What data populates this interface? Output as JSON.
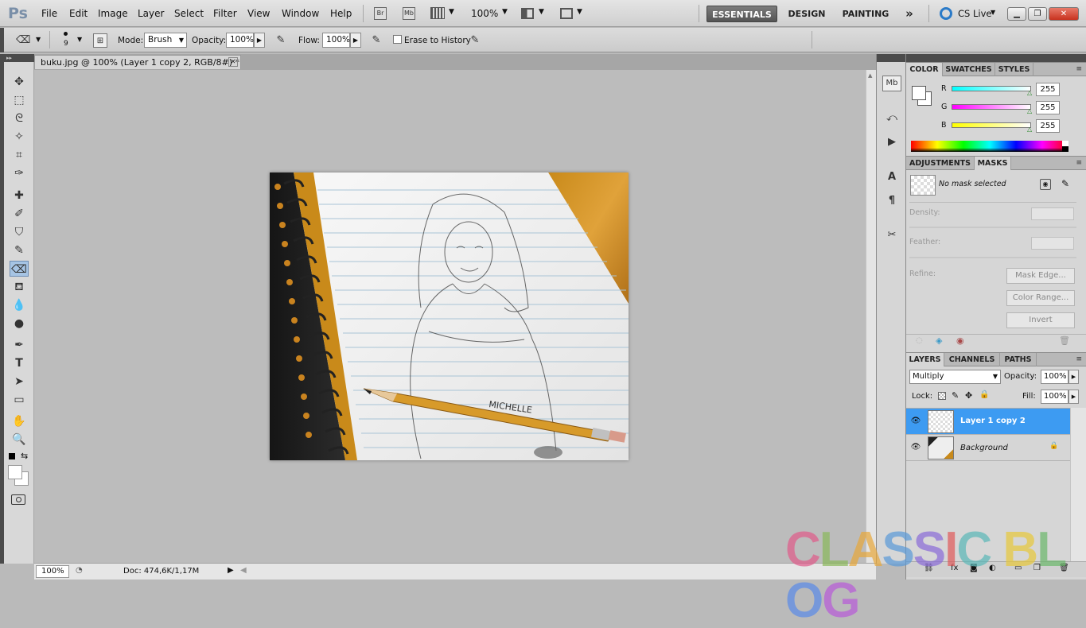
{
  "app": {
    "logo": "Ps"
  },
  "menu": [
    "File",
    "Edit",
    "Image",
    "Layer",
    "Select",
    "Filter",
    "View",
    "Window",
    "Help"
  ],
  "menubar_icons": {
    "bridge": "Br",
    "minibridge": "Mb",
    "zoom": "100%"
  },
  "workspaces": {
    "essentials": "ESSENTIALS",
    "design": "DESIGN",
    "painting": "PAINTING",
    "more": "»"
  },
  "cslive": "CS Live",
  "options": {
    "brush_size": "9",
    "mode_label": "Mode:",
    "mode_value": "Brush",
    "opacity_label": "Opacity:",
    "opacity_value": "100%",
    "flow_label": "Flow:",
    "flow_value": "100%",
    "erase_history_label": "Erase to History"
  },
  "document": {
    "tab_title": "buku.jpg @ 100% (Layer 1 copy 2, RGB/8#) *",
    "canvas_name_text": "MICHELLE"
  },
  "status": {
    "zoom": "100%",
    "doc": "Doc: 474,6K/1,17M"
  },
  "color_panel": {
    "tabs": [
      "COLOR",
      "SWATCHES",
      "STYLES"
    ],
    "channels": [
      {
        "label": "R",
        "value": "255",
        "color": "#00ffff"
      },
      {
        "label": "G",
        "value": "255",
        "color": "#ff00ff"
      },
      {
        "label": "B",
        "value": "255",
        "color": "#ffff00"
      }
    ]
  },
  "masks_panel": {
    "tabs": [
      "ADJUSTMENTS",
      "MASKS"
    ],
    "status": "No mask selected",
    "density_label": "Density:",
    "feather_label": "Feather:",
    "refine_label": "Refine:",
    "buttons": [
      "Mask Edge...",
      "Color Range...",
      "Invert"
    ]
  },
  "layers_panel": {
    "tabs": [
      "LAYERS",
      "CHANNELS",
      "PATHS"
    ],
    "blend_mode": "Multiply",
    "opacity_label": "Opacity:",
    "opacity_value": "100%",
    "lock_label": "Lock:",
    "fill_label": "Fill:",
    "fill_value": "100%",
    "layers": [
      {
        "name": "Layer 1 copy 2",
        "selected": true
      },
      {
        "name": "Background",
        "selected": false
      }
    ]
  },
  "watermark": {
    "letters": [
      "C",
      "L",
      "A",
      "S",
      "S",
      "I",
      "C",
      " ",
      "B",
      "L",
      "O",
      "G"
    ],
    "colors": [
      "#e05a8a",
      "#8ab85a",
      "#e8a83a",
      "#5a9ad8",
      "#8a6ad8",
      "#e05a5a",
      "#5ab8b8",
      "#ffffff",
      "#e8c83a",
      "#6ab86a",
      "#5a8ae8",
      "#b85ad8"
    ]
  },
  "colors": {
    "accent": "#3d9bf2",
    "panel_bg": "#d6d6d6",
    "canvas_bg": "#bcbcbc"
  }
}
